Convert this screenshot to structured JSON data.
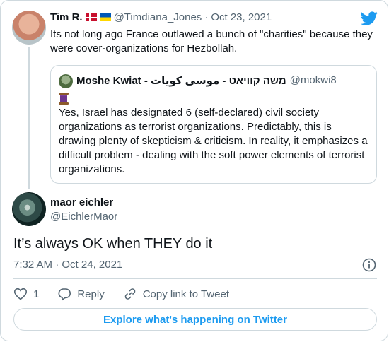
{
  "parent_tweet": {
    "author_name": "Tim R.",
    "handle": "@Timdiana_Jones",
    "separator": "·",
    "date": "Oct 23, 2021",
    "text": "Its not long ago France outlawed a bunch of \"charities\" because they were cover-organizations for Hezbollah.",
    "flags": [
      "flag-denmark",
      "flag-ukraine"
    ]
  },
  "quoted_tweet": {
    "author_name": "Moshe Kwiat - משה קוויאט - موسى كويات",
    "handle": "@mokwi8",
    "text": "Yes, Israel has designated 6 (self-declared) civil society organizations as terrorist organizations. Predictably, this is drawing plenty of skepticism & criticism. In reality, it emphasizes a difficult problem - dealing with the soft power elements of terrorist organizations.",
    "emoji": "thread-spool-icon"
  },
  "main_tweet": {
    "author_name": "maor eichler",
    "handle": "@EichlerMaor",
    "text": "It’s always OK when THEY do it",
    "time": "7:32 AM",
    "separator": "·",
    "date": "Oct 24, 2021"
  },
  "actions": {
    "like_count": "1",
    "reply_label": "Reply",
    "copy_label": "Copy link to Tweet"
  },
  "explore_label": "Explore what's happening on Twitter",
  "colors": {
    "accent": "#1d9bf0",
    "muted": "#536471",
    "border": "#cfd9de",
    "like_icon": "#536471"
  },
  "icons": [
    "twitter-bird-icon",
    "info-icon",
    "heart-icon",
    "reply-icon",
    "link-icon"
  ]
}
